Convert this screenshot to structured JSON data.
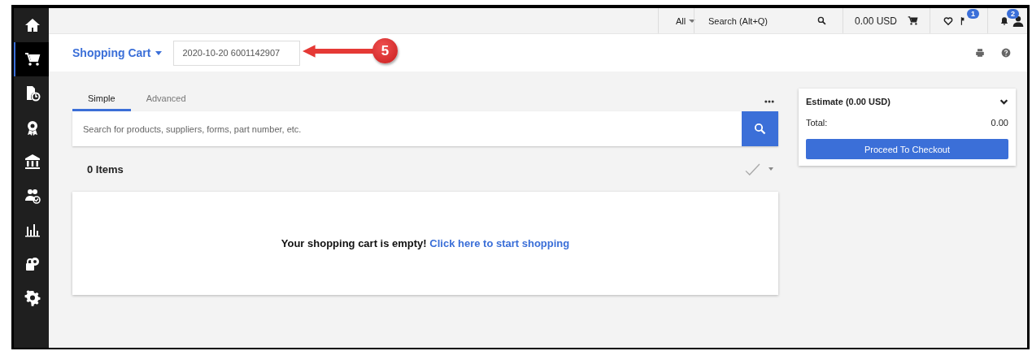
{
  "sidebar": {
    "items": [
      {
        "kind": "home",
        "selected": false
      },
      {
        "kind": "cart",
        "selected": true
      },
      {
        "kind": "document-clock",
        "selected": false
      },
      {
        "kind": "award",
        "selected": false
      },
      {
        "kind": "bank",
        "selected": false
      },
      {
        "kind": "people",
        "selected": false
      },
      {
        "kind": "chart",
        "selected": false
      },
      {
        "kind": "lock-gear",
        "selected": false
      },
      {
        "kind": "gear",
        "selected": false
      }
    ]
  },
  "top_bar": {
    "scope": "All",
    "search_placeholder": "Search (Alt+Q)",
    "cart_total": "0.00 USD",
    "flag_badge": "1",
    "bell_badge": "2"
  },
  "header": {
    "title": "Shopping Cart",
    "cart_name": "2020-10-20 6001142907",
    "annotation": {
      "label": "5"
    }
  },
  "search": {
    "tabs": [
      {
        "label": "Simple",
        "selected": true
      },
      {
        "label": "Advanced",
        "selected": false
      }
    ],
    "placeholder": "Search for products, suppliers, forms, part number, etc."
  },
  "cart": {
    "count": "0 Items",
    "message": "Your shopping cart is empty!",
    "link": "Click here to start shopping"
  },
  "estimate": {
    "title": "Estimate (0.00 USD)",
    "total_label": "Total:",
    "total_value": "0.00",
    "button": "Proceed To Checkout"
  }
}
